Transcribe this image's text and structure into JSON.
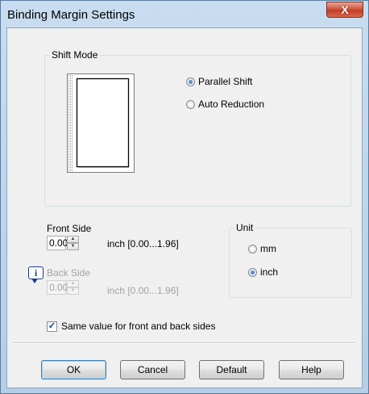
{
  "window": {
    "title": "Binding Margin Settings",
    "close_glyph": "X"
  },
  "shift_mode": {
    "group_title": "Shift Mode",
    "options": [
      {
        "label": "Parallel Shift",
        "selected": true
      },
      {
        "label": "Auto Reduction",
        "selected": false
      }
    ]
  },
  "front_side": {
    "label": "Front Side",
    "value": "0.00",
    "range": "inch [0.00...1.96]",
    "enabled": true
  },
  "back_side": {
    "label": "Back Side",
    "value": "0.00",
    "range": "inch [0.00...1.96]",
    "enabled": false
  },
  "unit": {
    "group_title": "Unit",
    "options": [
      {
        "label": "mm",
        "selected": false
      },
      {
        "label": "inch",
        "selected": true
      }
    ]
  },
  "same_value": {
    "label": "Same value for front and back sides",
    "checked": true
  },
  "buttons": {
    "ok": "OK",
    "cancel": "Cancel",
    "default": "Default",
    "help": "Help"
  },
  "icons": {
    "info": "info-icon",
    "close": "close-icon"
  },
  "colors": {
    "accent": "#3c7fb1",
    "title_bar": "#b5cde6",
    "close_button": "#c33d28"
  }
}
